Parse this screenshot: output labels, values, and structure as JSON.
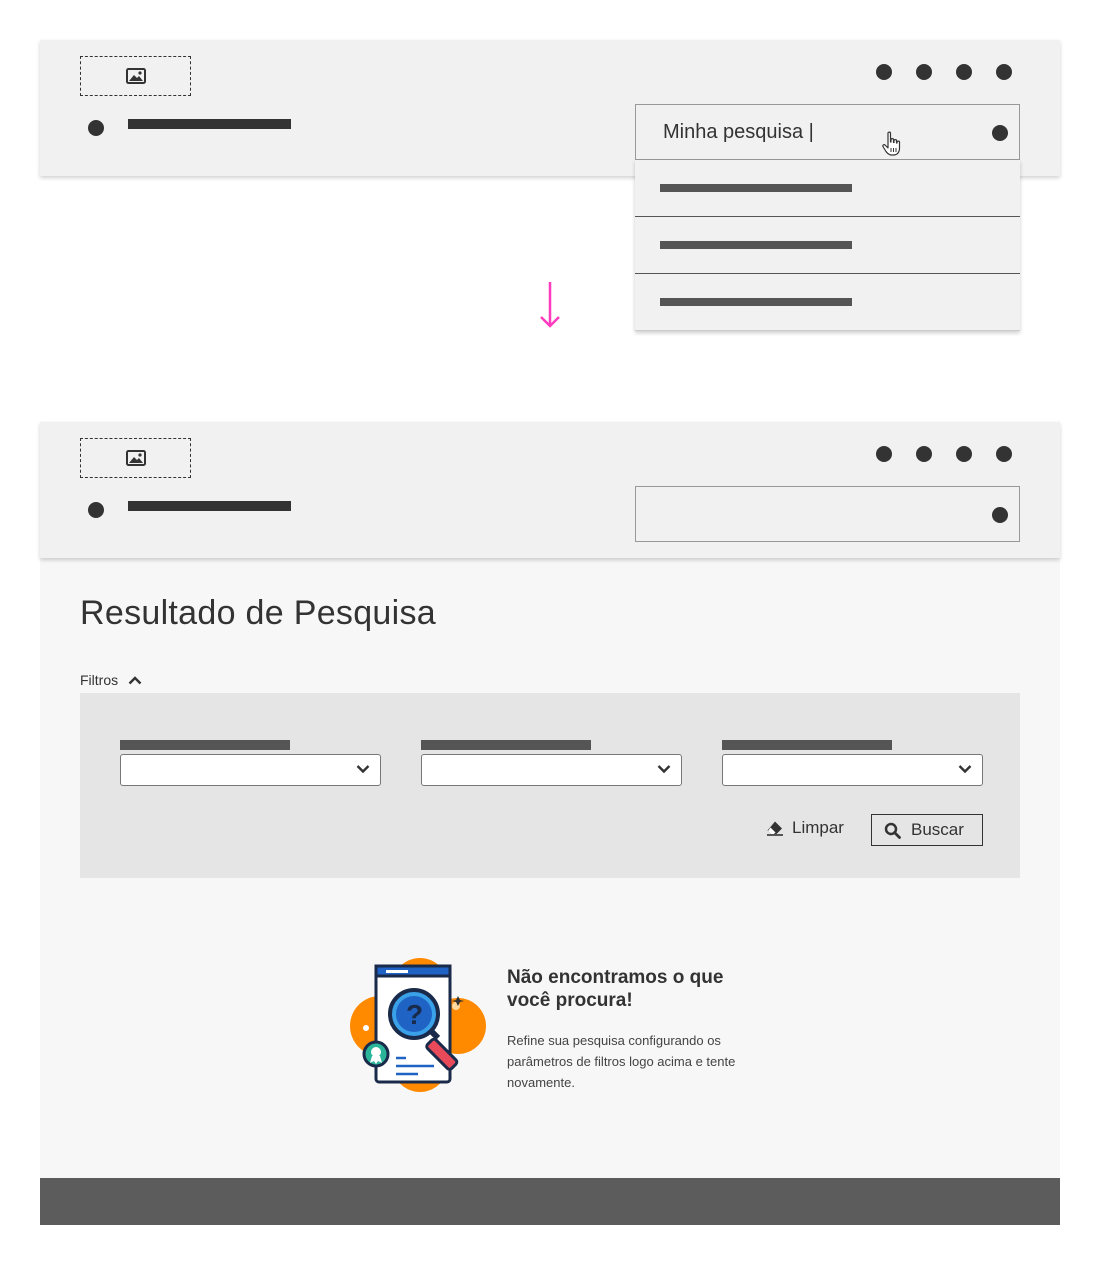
{
  "header_top": {
    "logo_icon": "image-icon",
    "nav_dots_count": 4,
    "search": {
      "value": "Minha pesquisa |",
      "suggestions": [
        "",
        "",
        ""
      ]
    }
  },
  "transition": {
    "arrow_color": "#ff3cbe"
  },
  "header_bottom": {
    "logo_icon": "image-icon",
    "search": {
      "value": ""
    }
  },
  "main": {
    "title": "Resultado de Pesquisa",
    "filters_label": "Filtros",
    "filters": [
      {
        "selected": ""
      },
      {
        "selected": ""
      },
      {
        "selected": ""
      }
    ],
    "clear_label": "Limpar",
    "search_label": "Buscar",
    "empty_state": {
      "title": "Não encontramos o que você procura!",
      "description": "Refine sua pesquisa configurando os parâmetros de filtros logo acima e tente novamente."
    }
  },
  "colors": {
    "header_bg": "#f2f1f2",
    "panel_bg": "#e5e5e5",
    "footer_bg": "#5c5c5c",
    "accent_orange": "#ff8a00",
    "accent_blue": "#1f63c4",
    "accent_pink": "#ff3cbe"
  }
}
